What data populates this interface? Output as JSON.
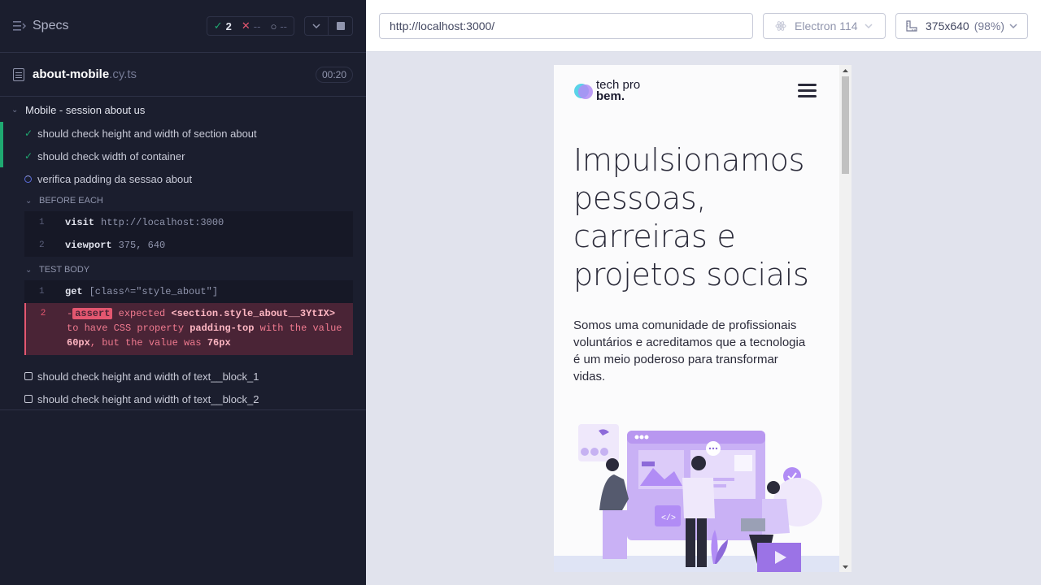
{
  "runner": {
    "specs_label": "Specs",
    "stats": {
      "passed": "2",
      "failed": "--",
      "pending": "--"
    },
    "file": {
      "name": "about-mobile",
      "ext": ".cy.ts",
      "timer": "00:20"
    },
    "suite": {
      "title": "Mobile - session about us",
      "tests": [
        {
          "label": "should check height and width of section about",
          "state": "passed"
        },
        {
          "label": "should check width of container",
          "state": "passed"
        },
        {
          "label": "verifica padding da sessao about",
          "state": "running"
        },
        {
          "label": "should check height and width of text__block_1",
          "state": "pending"
        },
        {
          "label": "should check height and width of text__block_2",
          "state": "pending"
        }
      ],
      "before_each": {
        "label": "BEFORE EACH",
        "commands": [
          {
            "num": "1",
            "name": "visit",
            "msg": "http://localhost:3000"
          },
          {
            "num": "2",
            "name": "viewport",
            "msg": "375, 640"
          }
        ]
      },
      "test_body": {
        "label": "TEST BODY",
        "commands": [
          {
            "num": "1",
            "name": "get",
            "msg": "[class^=\"style_about\"]"
          }
        ],
        "error": {
          "num": "2",
          "prefix": "-",
          "tag": "assert",
          "part1": "expected",
          "subject": "<section.style_about__3YtIX>",
          "part2": "to have CSS property",
          "prop": "padding-top",
          "part3": "with the value",
          "expected": "60px",
          "part4": ", but the value was",
          "actual": "76px"
        }
      }
    }
  },
  "preview": {
    "url": "http://localhost:3000/",
    "browser": "Electron 114",
    "viewport": "375x640",
    "zoom": "(98%)",
    "app": {
      "logo_line1": "tech pro",
      "logo_line2": "bem.",
      "hero_title": "Impulsionamos pessoas, carreiras e projetos sociais",
      "hero_text": "Somos uma comunidade de profissionais voluntários e acreditamos que a tecnologia é um meio poderoso para transformar vidas."
    }
  },
  "colors": {
    "pass": "#1fa971",
    "fail": "#e45770",
    "running": "#5a6bd9",
    "accent_purple": "#b89cf0"
  }
}
